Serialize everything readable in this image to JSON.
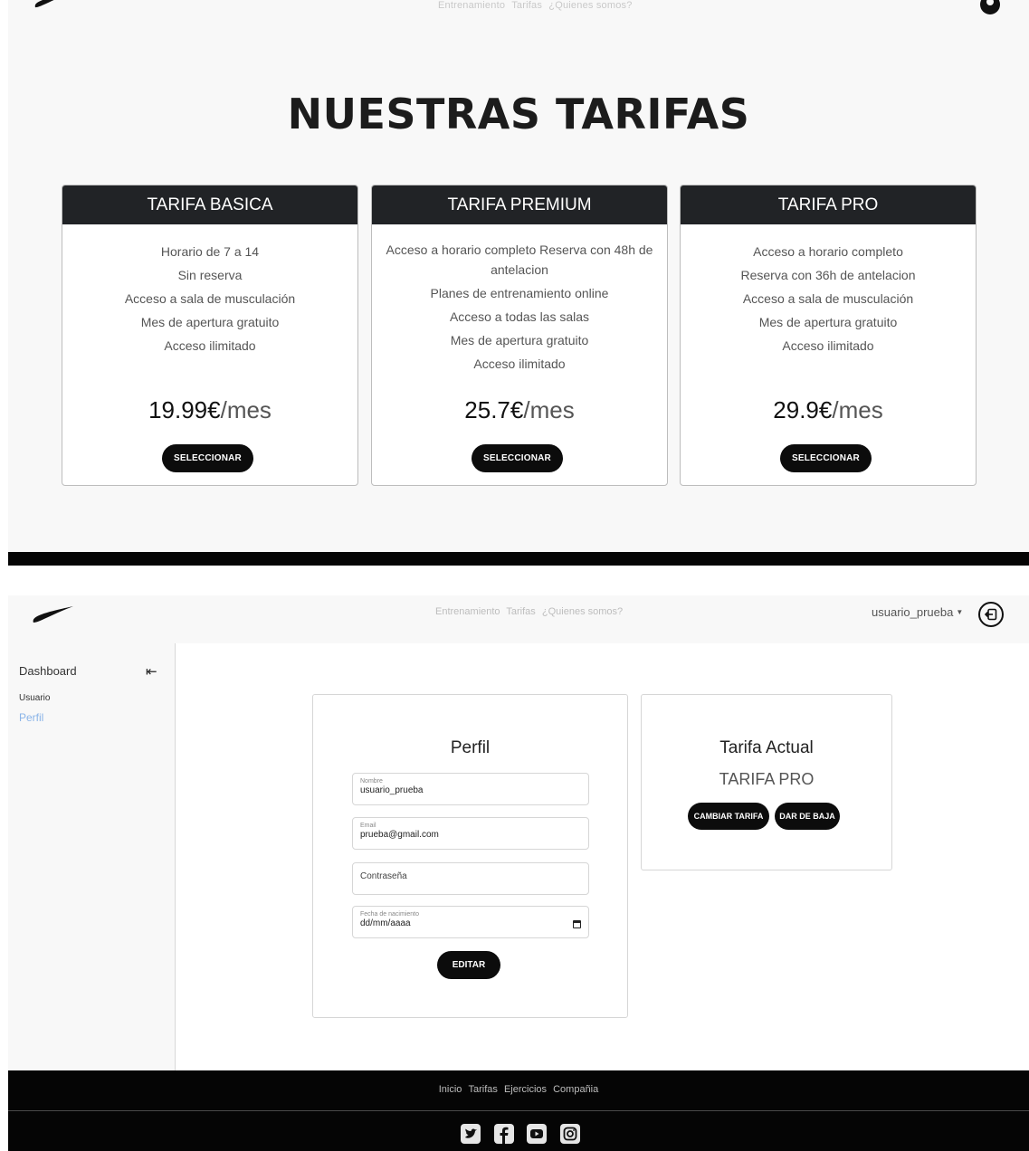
{
  "top": {
    "nav_links": [
      "Entrenamiento",
      "Tarifas",
      "¿Quienes somos?"
    ]
  },
  "tarifas": {
    "title": "NUESTRAS TARIFAS",
    "plans": [
      {
        "name": "TARIFA BASICA",
        "features": [
          "Horario de 7 a 14",
          "Sin reserva",
          "Acceso a sala de musculación",
          "Mes de apertura gratuito",
          "Acceso ilimitado"
        ],
        "price": "19.99€",
        "period": "/mes",
        "button": "SELECCIONAR"
      },
      {
        "name": "TARIFA PREMIUM",
        "features": [
          "Acceso a horario completo Reserva con 48h de antelacion",
          "Planes de entrenamiento online",
          "Acceso a todas las salas",
          "Mes de apertura gratuito",
          "Acceso ilimitado"
        ],
        "price": "25.7€",
        "period": "/mes",
        "button": "SELECCIONAR"
      },
      {
        "name": "TARIFA PRO",
        "features": [
          "Acceso a horario completo",
          "Reserva con 36h de antelacion",
          "Acceso a sala de musculación",
          "Mes de apertura gratuito",
          "Acceso ilimitado"
        ],
        "price": "29.9€",
        "period": "/mes",
        "button": "SELECCIONAR"
      }
    ]
  },
  "app_nav": {
    "links": [
      "Entrenamiento",
      "Tarifas",
      "¿Quienes somos?"
    ],
    "username": "usuario_prueba"
  },
  "sidebar": {
    "title": "Dashboard",
    "section": "Usuario",
    "link": "Perfil"
  },
  "profile": {
    "title": "Perfil",
    "name_label": "Nombre",
    "name_value": "usuario_prueba",
    "email_label": "Email",
    "email_value": "prueba@gmail.com",
    "password_placeholder": "Contraseña",
    "birthdate_label": "Fecha de nacimiento",
    "birthdate_value": "dd/mm/aaaa",
    "edit_button": "EDITAR"
  },
  "current_plan": {
    "title": "Tarifa Actual",
    "name": "TARIFA PRO",
    "change_button": "CAMBIAR TARIFA",
    "cancel_button": "DAR DE BAJA"
  },
  "footer": {
    "links": [
      "Inicio",
      "Tarifas",
      "Ejercicios",
      "Compañia"
    ],
    "social_icons": [
      "twitter-icon",
      "facebook-icon",
      "youtube-icon",
      "instagram-icon"
    ]
  },
  "colors": {
    "dark": "#212326",
    "black": "#050505",
    "link_blue": "#8ab4e8",
    "light_bg": "#f8f8f8"
  }
}
